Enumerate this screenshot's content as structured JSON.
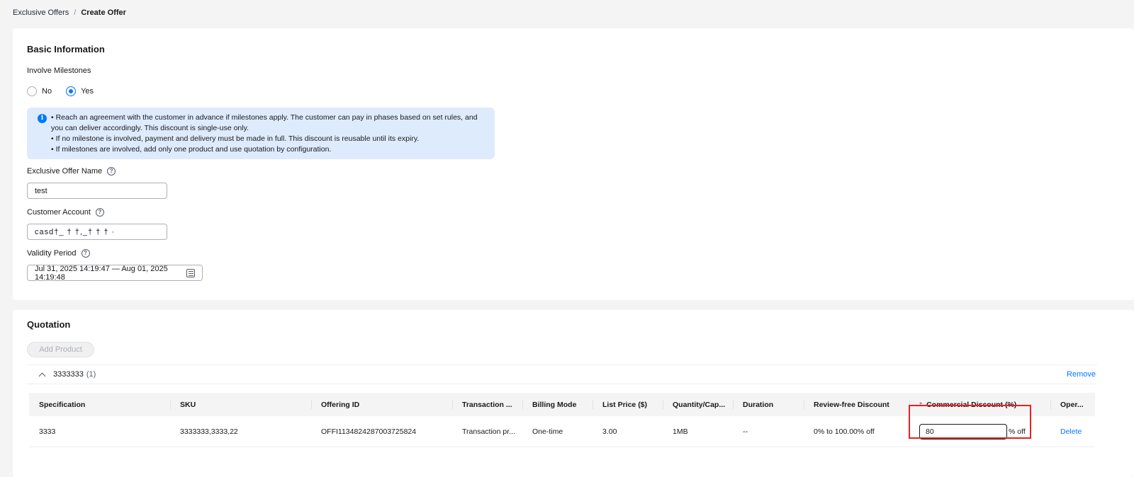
{
  "breadcrumb": {
    "parent": "Exclusive Offers",
    "separator": "/",
    "current": "Create Offer"
  },
  "basic": {
    "title": "Basic Information",
    "milestones": {
      "label": "Involve Milestones",
      "options": [
        "No",
        "Yes"
      ],
      "selected": "Yes"
    },
    "info": [
      "• Reach an agreement with the customer in advance if milestones apply. The customer can pay in phases based on set rules, and you can deliver accordingly. This discount is single-use only.",
      "• If no milestone is involved, payment and delivery must be made in full. This discount is reusable until its expiry.",
      "• If milestones are involved, add only one product and use quotation by configuration."
    ],
    "offer_name": {
      "label": "Exclusive Offer Name",
      "value": "test"
    },
    "customer_account": {
      "label": "Customer Account",
      "value": "casd†_ † †,_† † † ·"
    },
    "validity": {
      "label": "Validity Period",
      "value": "Jul 31, 2025 14:19:47 — Aug 01, 2025 14:19:48"
    }
  },
  "quotation": {
    "title": "Quotation",
    "add_product": "Add Product",
    "group": {
      "name": "3333333",
      "count": "(1)",
      "remove": "Remove"
    },
    "columns": [
      "Specification",
      "SKU",
      "Offering ID",
      "Transaction ...",
      "Billing Mode",
      "List Price ($)",
      "Quantity/Cap...",
      "Duration",
      "Review-free Discount",
      "Commercial Discount (%)",
      "Oper..."
    ],
    "row": {
      "specification": "3333",
      "sku": "3333333,3333,22",
      "offering_id": "OFFI1134824287003725824",
      "transaction": "Transaction pr...",
      "billing_mode": "One-time",
      "list_price": "3.00",
      "quantity": "1MB",
      "duration": "--",
      "review_free": "0% to 100.00% off",
      "commercial_discount": "80",
      "discount_suffix": "% off",
      "operation": "Delete"
    },
    "required_mark": "*"
  },
  "colors": {
    "accent": "#0077ff",
    "highlight": "#e52222",
    "info_bg": "#ddebfd"
  }
}
